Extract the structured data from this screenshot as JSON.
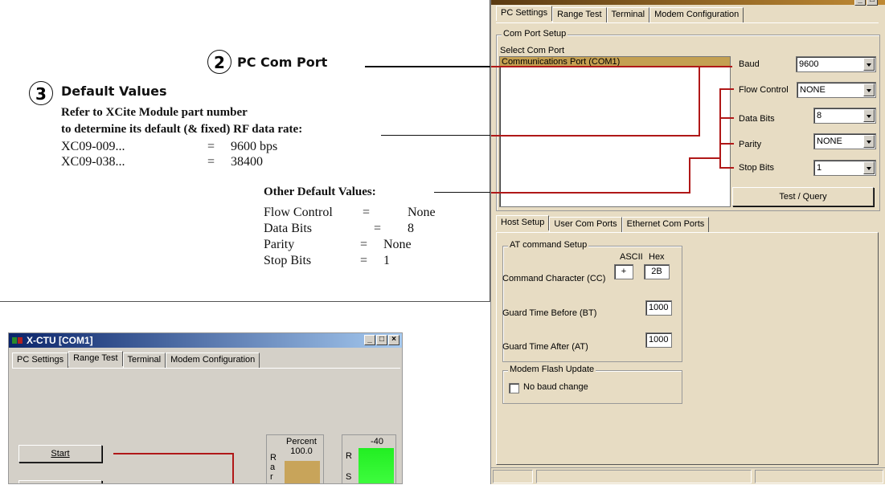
{
  "annotation": {
    "callout2": {
      "number": "2",
      "label": "PC Com Port"
    },
    "callout3": {
      "number": "3",
      "label": "Default Values"
    },
    "refer_line1": "Refer to XCite Module part number",
    "refer_line2": "to determine its default (& fixed) RF data rate:",
    "rates": [
      {
        "part": "XC09-009...",
        "eq": "=",
        "value": "9600 bps"
      },
      {
        "part": "XC09-038...",
        "eq": "=",
        "value": "38400"
      }
    ],
    "other_title": "Other Default Values:",
    "other": [
      {
        "name": "Flow Control",
        "eq": "=",
        "value": "None"
      },
      {
        "name": "Data Bits",
        "eq": "=",
        "value": "8"
      },
      {
        "name": "Parity",
        "eq": "=",
        "value": "None"
      },
      {
        "name": "Stop Bits",
        "eq": "=",
        "value": "1"
      }
    ]
  },
  "main_window": {
    "tabs": [
      "PC Settings",
      "Range Test",
      "Terminal",
      "Modem Configuration"
    ],
    "com_port_setup": {
      "group_title": "Com Port Setup",
      "select_label": "Select Com Port",
      "selected_port": "Communications Port (COM1)",
      "baud_label": "Baud",
      "baud_value": "9600",
      "flow_label": "Flow Control",
      "flow_value": "NONE",
      "databits_label": "Data Bits",
      "databits_value": "8",
      "parity_label": "Parity",
      "parity_value": "NONE",
      "stopbits_label": "Stop Bits",
      "stopbits_value": "1",
      "test_button": "Test / Query"
    },
    "lower_tabs": [
      "Host Setup",
      "User Com Ports",
      "Ethernet Com Ports"
    ],
    "at_setup": {
      "group_title": "AT command Setup",
      "ascii_label": "ASCII",
      "hex_label": "Hex",
      "cc_label": "Command Character (CC)",
      "cc_ascii": "+",
      "cc_hex": "2B",
      "bt_label": "Guard Time Before (BT)",
      "bt_value": "1000",
      "at_label": "Guard Time After (AT)",
      "at_value": "1000"
    },
    "flash": {
      "group_title": "Modem Flash Update",
      "no_baud_label": "No baud change",
      "no_baud_checked": false
    }
  },
  "small_window": {
    "title": "X-CTU  [COM1]",
    "tabs": [
      "PC Settings",
      "Range Test",
      "Terminal",
      "Modem Configuration"
    ],
    "start_button": "Start",
    "percent_label": "Percent",
    "percent_value": "100.0",
    "rssi_value": "-40",
    "vertical_labels": [
      "R",
      "a",
      "r"
    ],
    "rssi_letters": [
      "R",
      "S"
    ]
  }
}
